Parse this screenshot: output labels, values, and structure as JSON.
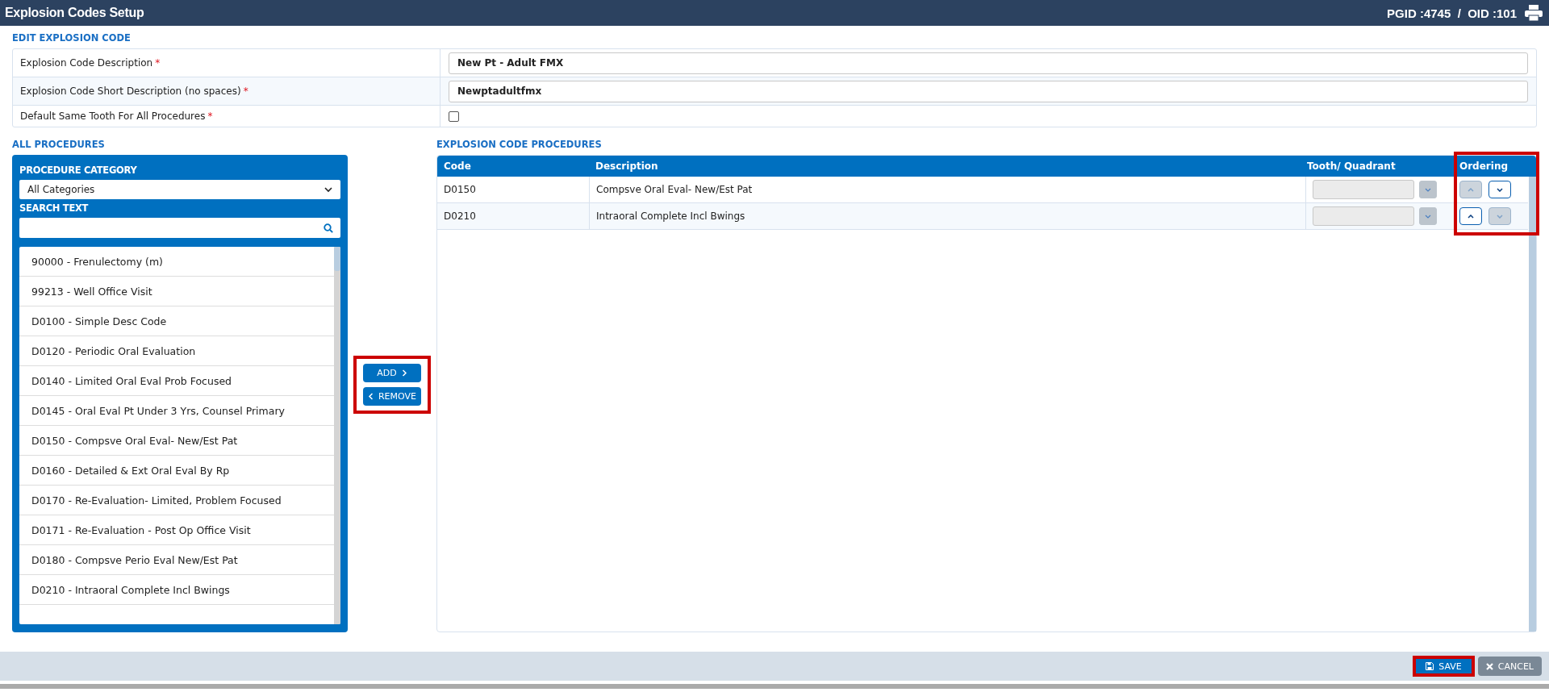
{
  "header": {
    "title": "Explosion Codes Setup",
    "ids": "PGID :4745  /  OID :101"
  },
  "edit_section": {
    "title": "EDIT EXPLOSION CODE",
    "fields": [
      {
        "kind": "text",
        "label": "Explosion Code Description",
        "required_mark": "*",
        "value": "New Pt - Adult FMX"
      },
      {
        "kind": "text",
        "label": "Explosion Code Short Description (no spaces)",
        "required_mark": "*",
        "value": "Newptadultfmx"
      },
      {
        "kind": "checkbox",
        "label": "Default Same Tooth For All Procedures",
        "required_mark": "*",
        "checked": false
      }
    ]
  },
  "all_procedures": {
    "title": "ALL PROCEDURES",
    "category_label": "PROCEDURE CATEGORY",
    "category_value": "All Categories",
    "search_label": "SEARCH TEXT",
    "items": [
      "90000 - Frenulectomy (m)",
      "99213 - Well Office Visit",
      "D0100 - Simple Desc Code",
      "D0120 - Periodic Oral Evaluation",
      "D0140 - Limited Oral Eval Prob Focused",
      "D0145 - Oral Eval Pt Under 3 Yrs, Counsel Primary",
      "D0150 - Compsve Oral Eval- New/Est Pat",
      "D0160 - Detailed & Ext Oral Eval By Rp",
      "D0170 - Re-Evaluation- Limited, Problem Focused",
      "D0171 - Re-Evaluation - Post Op Office Visit",
      "D0180 - Compsve Perio Eval New/Est Pat",
      "D0210 - Intraoral Complete Incl Bwings"
    ]
  },
  "transfer": {
    "highlighted": true,
    "add": "ADD",
    "remove": "REMOVE"
  },
  "explosion_procedures": {
    "title": "EXPLOSION CODE PROCEDURES",
    "columns": [
      "Code",
      "Description",
      "Tooth/ Quadrant",
      "Ordering"
    ],
    "ordering_highlighted": true,
    "rows": [
      {
        "code": "D0150",
        "description": "Compsve Oral Eval- New/Est Pat",
        "tooth_disabled": true,
        "up_disabled": true,
        "down_disabled": false
      },
      {
        "code": "D0210",
        "description": "Intraoral Complete Incl Bwings",
        "tooth_disabled": true,
        "up_disabled": false,
        "down_disabled": true
      }
    ]
  },
  "footer": {
    "save": "SAVE",
    "save_highlighted": true,
    "cancel": "CANCEL"
  }
}
